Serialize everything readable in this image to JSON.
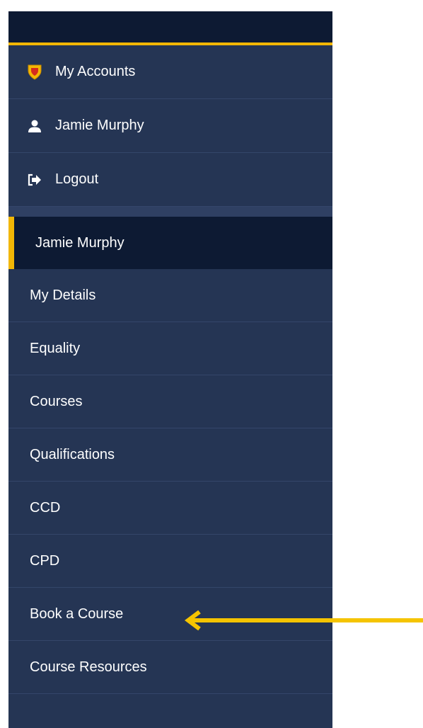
{
  "account_menu": {
    "items": [
      {
        "label": "My Accounts",
        "icon": "shield-icon"
      },
      {
        "label": "Jamie Murphy",
        "icon": "user-icon"
      },
      {
        "label": "Logout",
        "icon": "logout-icon"
      }
    ]
  },
  "nav": {
    "header": "Jamie Murphy",
    "items": [
      {
        "label": "My Details"
      },
      {
        "label": "Equality"
      },
      {
        "label": "Courses"
      },
      {
        "label": "Qualifications"
      },
      {
        "label": "CCD"
      },
      {
        "label": "CPD"
      },
      {
        "label": "Book a Course"
      },
      {
        "label": "Course Resources"
      }
    ]
  },
  "colors": {
    "sidebar_bg": "#253554",
    "header_bg": "#0d1a33",
    "accent": "#f2b705"
  }
}
